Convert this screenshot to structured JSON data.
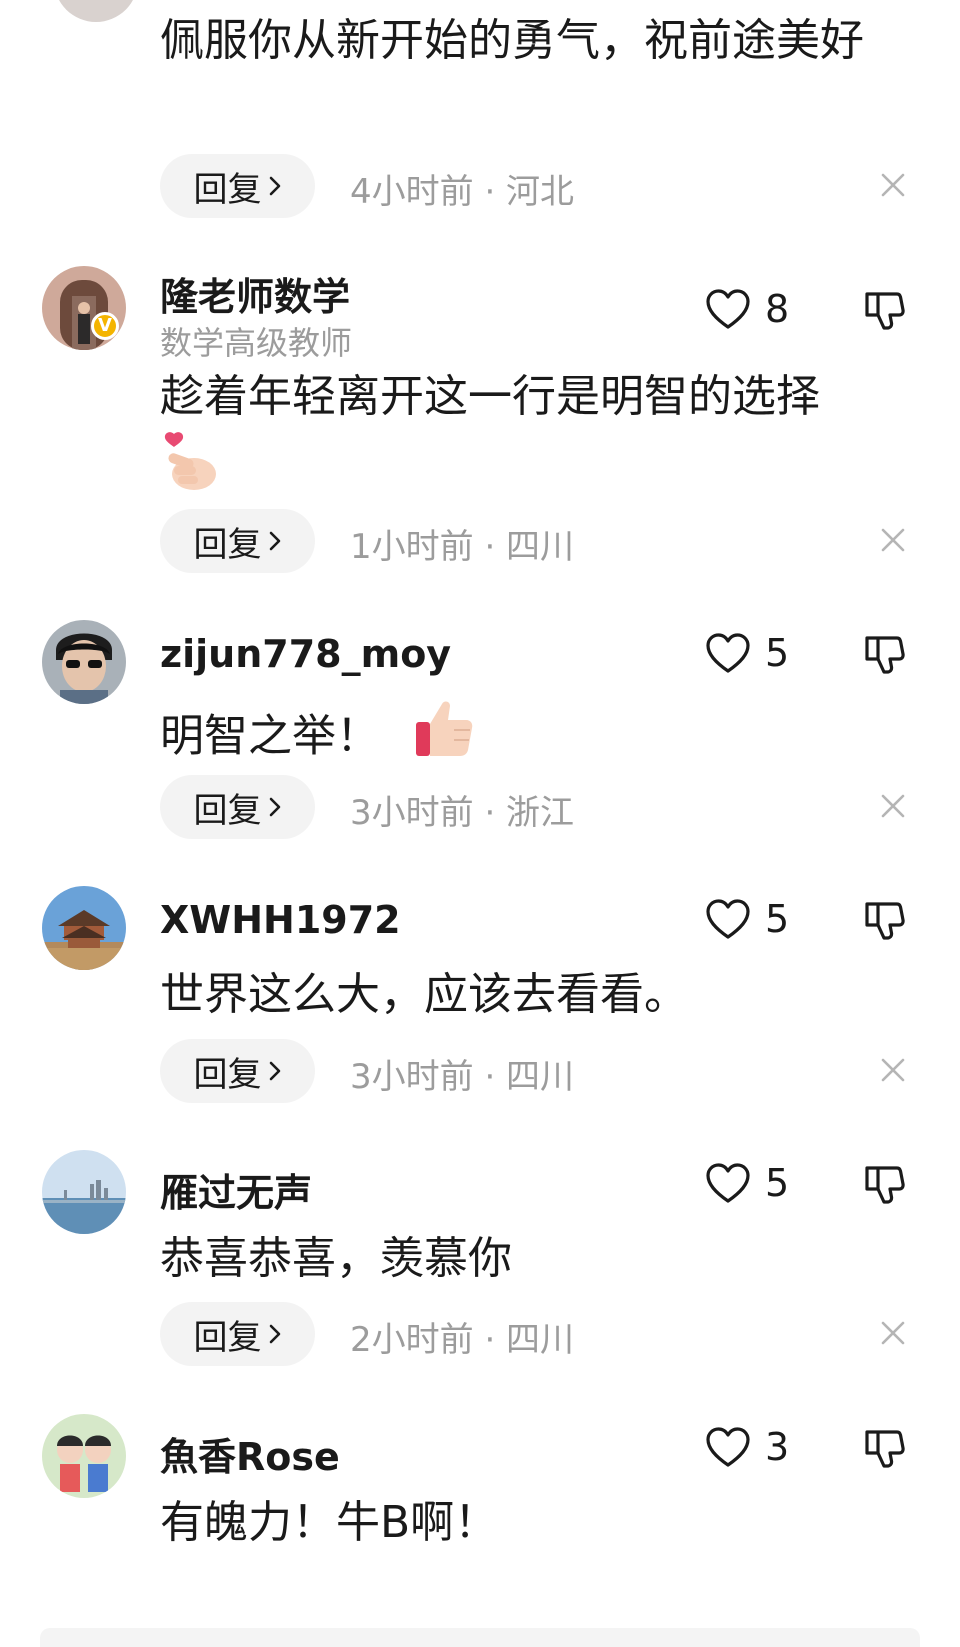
{
  "comments": [
    {
      "text": "佩服你从新开始的勇气，祝前途美好",
      "reply_label": "回复",
      "meta": "4小时前 · 河北"
    },
    {
      "username": "隆老师数学",
      "subtitle": "数学高级教师",
      "text": "趁着年轻离开这一行是明智的选择",
      "emoji": "finger-heart",
      "likes": "8",
      "verified": "V",
      "reply_label": "回复",
      "meta": "1小时前 · 四川"
    },
    {
      "username": "zijun778_moy",
      "text": "明智之举！",
      "emoji": "thumbs-up",
      "likes": "5",
      "reply_label": "回复",
      "meta": "3小时前 · 浙江"
    },
    {
      "username": "XWHH1972",
      "text": "世界这么大，应该去看看。",
      "likes": "5",
      "reply_label": "回复",
      "meta": "3小时前 · 四川"
    },
    {
      "username": "雁过无声",
      "text": "恭喜恭喜，羡慕你",
      "likes": "5",
      "reply_label": "回复",
      "meta": "2小时前 · 四川"
    },
    {
      "username": "魚香Rose",
      "text": "有魄力！牛B啊！",
      "likes": "3"
    }
  ],
  "icons": {
    "like": "heart-outline-icon",
    "dislike": "thumbs-down-outline-icon",
    "close": "close-icon",
    "chevron": "chevron-right-icon"
  },
  "colors": {
    "text": "#1a1a1a",
    "muted": "#9c9c9c",
    "reply_bg": "#f3f3f3",
    "verified": "#f4b400"
  }
}
